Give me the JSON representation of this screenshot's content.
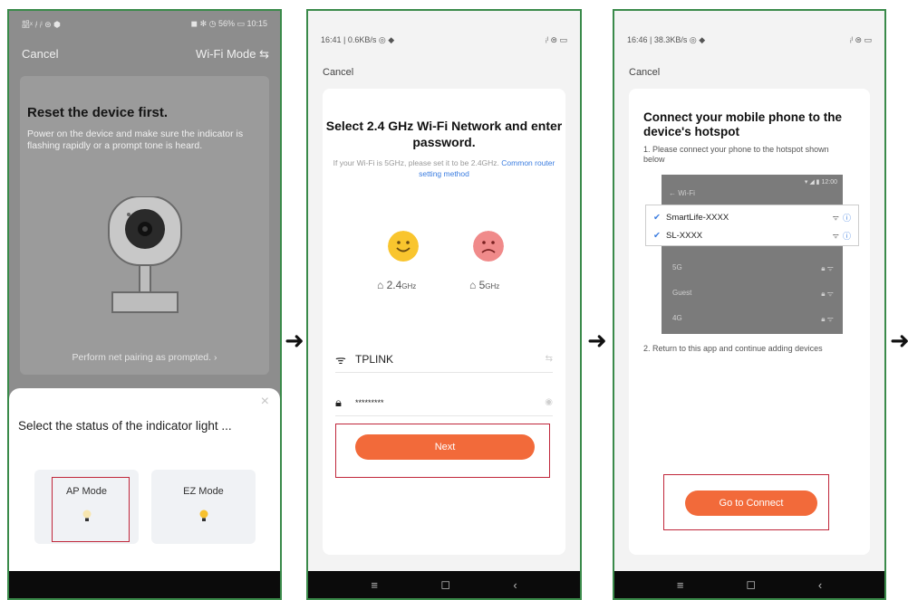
{
  "arrows": [
    "➜",
    "➜",
    "➜"
  ],
  "phone1": {
    "status_left": "㗊ˣ ᵢˡ ᵢˡ ⊜ ⬢",
    "status_right": "◼ ✻ ◷ 56% ▭ 10:15",
    "cancel": "Cancel",
    "wifi_mode": "Wi-Fi Mode ⇆",
    "title": "Reset the device first.",
    "description": "Power on the device and make sure the indicator is flashing rapidly or a prompt tone is heard.",
    "perform": "Perform net pairing as prompted. ›",
    "sheet_close": "×",
    "sheet_title": "Select the status of the indicator light ...",
    "ap_mode": "AP Mode",
    "ez_mode": "EZ Mode"
  },
  "phone2": {
    "status_left": "16:41 | 0.6KB/s ◎ ◆",
    "status_right": "ᵢˡ ⊜ ▭",
    "cancel": "Cancel",
    "title": "Select 2.4 GHz Wi-Fi Network and enter password.",
    "hint": "If your Wi-Fi is 5GHz, please set it to be 2.4GHz.",
    "hint_link": "Common router setting method",
    "band_24": "2.4",
    "band_24_unit": "GHz",
    "band_5": "5",
    "band_5_unit": "GHz",
    "ssid": "TPLINK",
    "password": "*********",
    "next": "Next",
    "nav": [
      "≡",
      "◻",
      "‹"
    ]
  },
  "phone3": {
    "status_left": "16:46 | 38.3KB/s ◎ ◆",
    "status_right": "ᵢˡ ⊜ ▭",
    "cancel": "Cancel",
    "title": "Connect your mobile phone to the device's hotspot",
    "step1": "1. Please connect your phone to the hotspot shown below",
    "wifi_header": "← Wi-Fi",
    "wifi_status": "▾ ◢ ▮ 12:00",
    "hotspot1": "SmartLife-XXXX",
    "hotspot2": "SL-XXXX",
    "other_networks": [
      "5G",
      "Guest",
      "4G"
    ],
    "step2": "2. Return to this app and continue adding devices",
    "connect": "Go to Connect",
    "nav": [
      "≡",
      "◻",
      "‹"
    ]
  },
  "colors": {
    "accent": "#f26a3a",
    "link": "#3a7ce0",
    "highlight": "#c0263a",
    "frame": "#3a8a4a"
  }
}
